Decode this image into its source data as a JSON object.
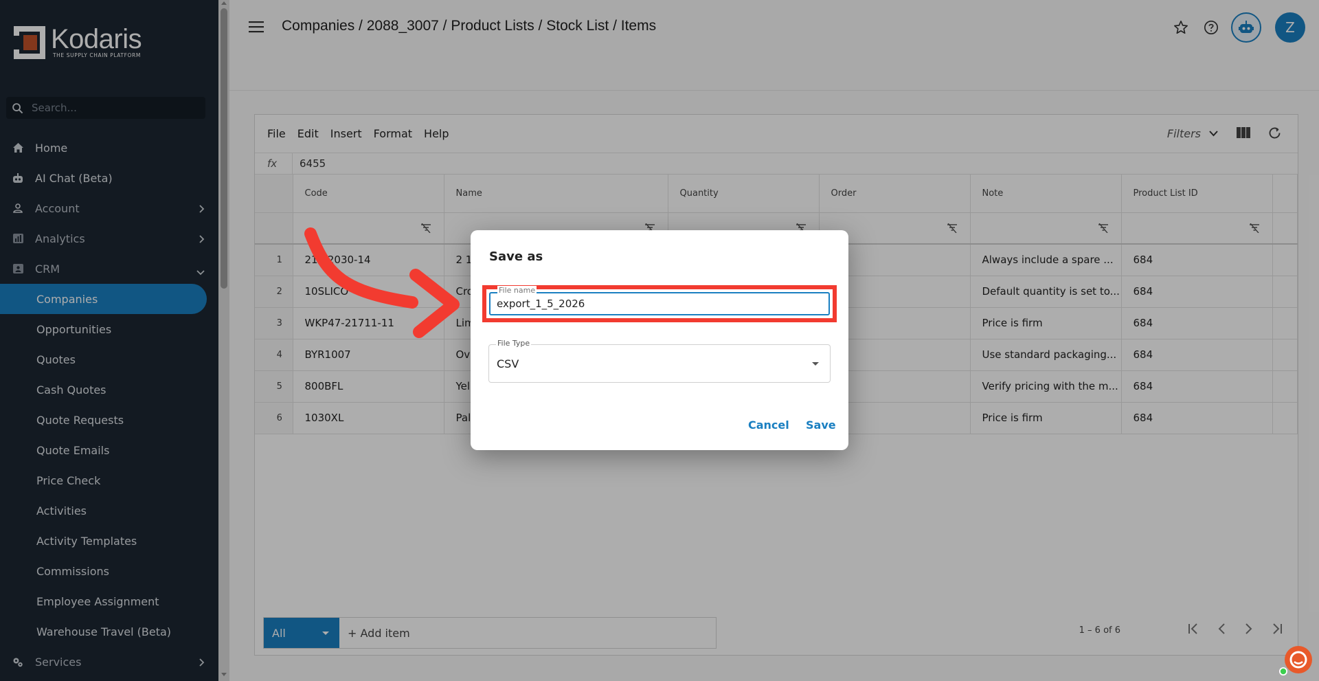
{
  "brand": {
    "name": "Kodaris",
    "tagline": "THE SUPPLY CHAIN PLATFORM"
  },
  "search": {
    "placeholder": "Search..."
  },
  "sidebar": {
    "items": [
      {
        "label": "Home",
        "icon": "home-icon"
      },
      {
        "label": "AI Chat (Beta)",
        "icon": "robot-icon"
      },
      {
        "label": "Account",
        "icon": "person-icon"
      },
      {
        "label": "Analytics",
        "icon": "chart-icon"
      },
      {
        "label": "CRM",
        "icon": "contacts-icon"
      },
      {
        "label": "Companies"
      },
      {
        "label": "Opportunities"
      },
      {
        "label": "Quotes"
      },
      {
        "label": "Cash Quotes"
      },
      {
        "label": "Quote Requests"
      },
      {
        "label": "Quote Emails"
      },
      {
        "label": "Price Check"
      },
      {
        "label": "Activities"
      },
      {
        "label": "Activity Templates"
      },
      {
        "label": "Commissions"
      },
      {
        "label": "Employee Assignment"
      },
      {
        "label": "Warehouse Travel (Beta)"
      },
      {
        "label": "Services",
        "icon": "gears-icon"
      }
    ]
  },
  "header": {
    "breadcrumb": "Companies / 2088_3007 / Product Lists / Stock List / Items",
    "avatar_initial": "Z"
  },
  "menubar": {
    "file": "File",
    "edit": "Edit",
    "insert": "Insert",
    "format": "Format",
    "help": "Help",
    "filters": "Filters"
  },
  "formula": {
    "fx": "fx",
    "value": "6455"
  },
  "table": {
    "columns": [
      "Code",
      "Name",
      "Quantity",
      "Order",
      "Note",
      "Product List ID"
    ],
    "rows": [
      {
        "n": "1",
        "code": "21 S2030-14",
        "name": "2 1",
        "note": "Always include a spare ...",
        "plid": "684"
      },
      {
        "n": "2",
        "code": "10SLICO",
        "name": "Cro",
        "note": "Default quantity is set to...",
        "plid": "684"
      },
      {
        "n": "3",
        "code": "WKP47-21711-11",
        "name": "Lim",
        "note": "Price is firm",
        "plid": "684"
      },
      {
        "n": "4",
        "code": "BYR1007",
        "name": "Ov",
        "note": "Use standard packaging...",
        "plid": "684"
      },
      {
        "n": "5",
        "code": "800BFL",
        "name": "Yel",
        "note": "Verify pricing with the m...",
        "plid": "684"
      },
      {
        "n": "6",
        "code": "1030XL",
        "name": "Pal",
        "note": "Price is firm",
        "plid": "684"
      }
    ]
  },
  "footer": {
    "filter_value": "All",
    "add_item": "+ Add item",
    "range": "1 – 6 of 6"
  },
  "dialog": {
    "title": "Save as",
    "file_name_label": "File name",
    "file_name_value": "export_1_5_2026",
    "file_type_label": "File Type",
    "file_type_value": "CSV",
    "cancel": "Cancel",
    "save": "Save"
  },
  "colors": {
    "accent": "#1a7fc1",
    "sidebar": "#1d2733",
    "highlight": "#f23b30"
  }
}
